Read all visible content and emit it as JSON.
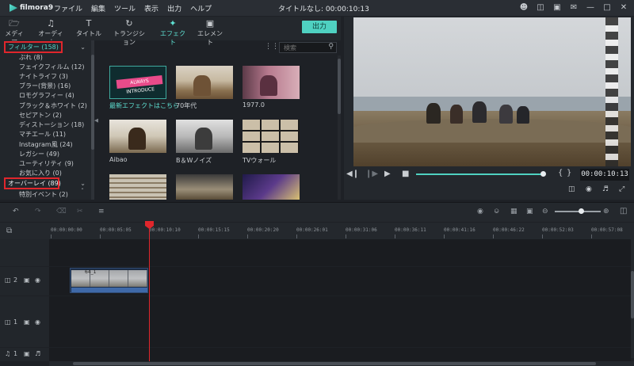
{
  "app": {
    "logo_text": "filmora9",
    "title": "タイトルなし: 00:00:10:13"
  },
  "menu": [
    "ファイル",
    "編集",
    "ツール",
    "表示",
    "出力",
    "ヘルプ"
  ],
  "window_icons": [
    "user-icon",
    "cart-icon",
    "gift-icon",
    "mail-icon",
    "minimize-icon",
    "maximize-icon",
    "close-icon"
  ],
  "tabs": [
    {
      "label": "メディア",
      "icon": "folder-icon"
    },
    {
      "label": "オーディオ",
      "icon": "music-note-icon"
    },
    {
      "label": "タイトル",
      "icon": "text-icon"
    },
    {
      "label": "トランジション",
      "icon": "transition-icon"
    },
    {
      "label": "エフェクト",
      "icon": "effects-icon",
      "active": true
    },
    {
      "label": "エレメント",
      "icon": "image-icon"
    }
  ],
  "export_label": "出力",
  "sidebar": {
    "filter_header": "フィルター (158)",
    "filter_items": [
      "ぶれ (8)",
      "フェイクフィルム (12)",
      "ナイトライフ (3)",
      "ブラー(背景) (16)",
      "ロモグラフィー (4)",
      "ブラック＆ホワイト (2)",
      "セピアトン (2)",
      "ディストーション (18)",
      "マチエール (11)",
      "Instagram風 (24)",
      "レガシー (49)",
      "ユーティリティ (9)",
      "お気に入り (0)"
    ],
    "overlay_header": "オーバーレイ (89)",
    "overlay_items": [
      "特別イベント (2)"
    ]
  },
  "search": {
    "placeholder": "検索"
  },
  "effects": [
    {
      "label": "最新エフェクトはこちら",
      "badge_text": "ALWAYS INTRODUCE",
      "label_color": "#5ee0d2"
    },
    {
      "label": "70年代"
    },
    {
      "label": "1977.0"
    },
    {
      "label": "Aibao"
    },
    {
      "label": "B＆Wノイズ"
    },
    {
      "label": "TVウォール"
    }
  ],
  "preview": {
    "timecode": "00:00:10:13"
  },
  "timeline": {
    "ruler": [
      "00:00:00:00",
      "00:00:05:05",
      "00:00:10:10",
      "00:00:15:15",
      "00:00:20:20",
      "00:00:26:01",
      "00:00:31:06",
      "00:00:36:11",
      "00:00:41:16",
      "00:00:46:22",
      "00:00:52:03",
      "00:00:57:08"
    ],
    "tracks": [
      {
        "label": "2",
        "icon": "video-track-icon"
      },
      {
        "label": "1",
        "icon": "video-track-icon"
      },
      {
        "label": "1",
        "icon": "audio-track-icon"
      }
    ],
    "clip_name": "64_1"
  },
  "colors": {
    "accent": "#4fd1c1",
    "highlight": "#e0262c",
    "playhead": "#e0262c"
  }
}
